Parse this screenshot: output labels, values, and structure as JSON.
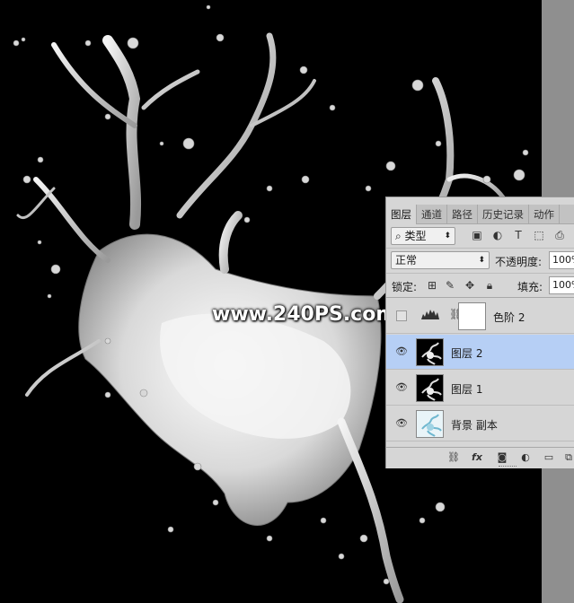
{
  "watermark": "www.240PS.com",
  "panel": {
    "tabs": [
      {
        "label": "图层",
        "active": true
      },
      {
        "label": "通道",
        "active": false
      },
      {
        "label": "路径",
        "active": false
      },
      {
        "label": "历史记录",
        "active": false
      },
      {
        "label": "动作",
        "active": false
      }
    ],
    "filter": {
      "kind_label": "类型",
      "icons": [
        "image-icon",
        "adjustment-icon",
        "text-icon",
        "shape-icon",
        "smart-object-icon"
      ]
    },
    "blend_mode": "正常",
    "opacity_label": "不透明度:",
    "opacity_value": "100%",
    "lock_label": "锁定:",
    "fill_label": "填充:",
    "fill_value": "100%",
    "layers": [
      {
        "name": "色阶 2",
        "visible": false,
        "selected": false,
        "type": "adjustment"
      },
      {
        "name": "图层 2",
        "visible": true,
        "selected": true,
        "type": "pixel-dark"
      },
      {
        "name": "图层 1",
        "visible": true,
        "selected": false,
        "type": "pixel-dark"
      },
      {
        "name": "背景 副本",
        "visible": true,
        "selected": false,
        "type": "pixel-light"
      }
    ],
    "bottom_icons": [
      "link-icon",
      "fx-icon",
      "mask-icon",
      "adjustment-layer-icon",
      "group-icon",
      "new-layer-icon"
    ],
    "fx_label": "fx"
  },
  "colors": {
    "canvas_bg": "#000000",
    "panel_bg": "#d6d6d6",
    "selected_row": "#b6cff5",
    "gutter": "#8f8f8f"
  }
}
